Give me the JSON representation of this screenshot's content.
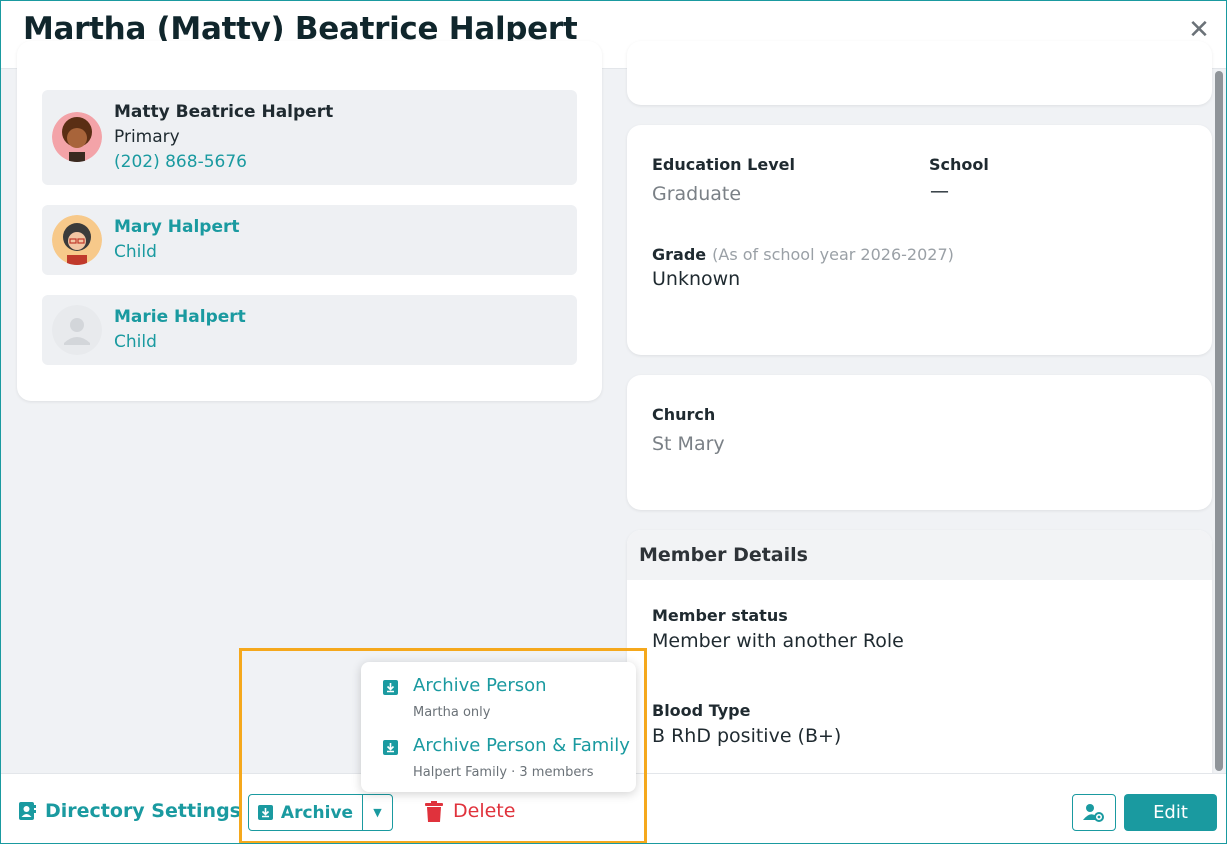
{
  "window": {
    "title": "Martha (Matty) Beatrice Halpert",
    "close_glyph": "✕"
  },
  "family_members": [
    {
      "name": "Matty Beatrice Halpert",
      "role": "Primary",
      "phone": "(202) 868-5676"
    },
    {
      "name": "Mary Halpert",
      "role": "Child"
    },
    {
      "name": "Marie Halpert",
      "role": "Child"
    }
  ],
  "education": {
    "level_label": "Education Level",
    "level_value": "Graduate",
    "school_label": "School",
    "school_value": "—",
    "grade_label": "Grade",
    "grade_hint": "(As of school year 2026-2027)",
    "grade_value": "Unknown"
  },
  "church": {
    "label": "Church",
    "value": "St Mary"
  },
  "member_details": {
    "heading": "Member Details",
    "status_label": "Member status",
    "status_value": "Member with another Role",
    "blood_label": "Blood Type",
    "blood_value": "B RhD positive (B+)"
  },
  "footer": {
    "directory_settings": "Directory Settings",
    "archive": "Archive",
    "delete": "Delete",
    "edit": "Edit"
  },
  "archive_menu": [
    {
      "label": "Archive Person",
      "sub": "Martha only"
    },
    {
      "label": "Archive Person & Family",
      "sub": "Halpert Family · 3 members"
    }
  ],
  "colors": {
    "accent": "#1a9aa0",
    "danger": "#e0323c",
    "highlight": "#f5a81c"
  }
}
